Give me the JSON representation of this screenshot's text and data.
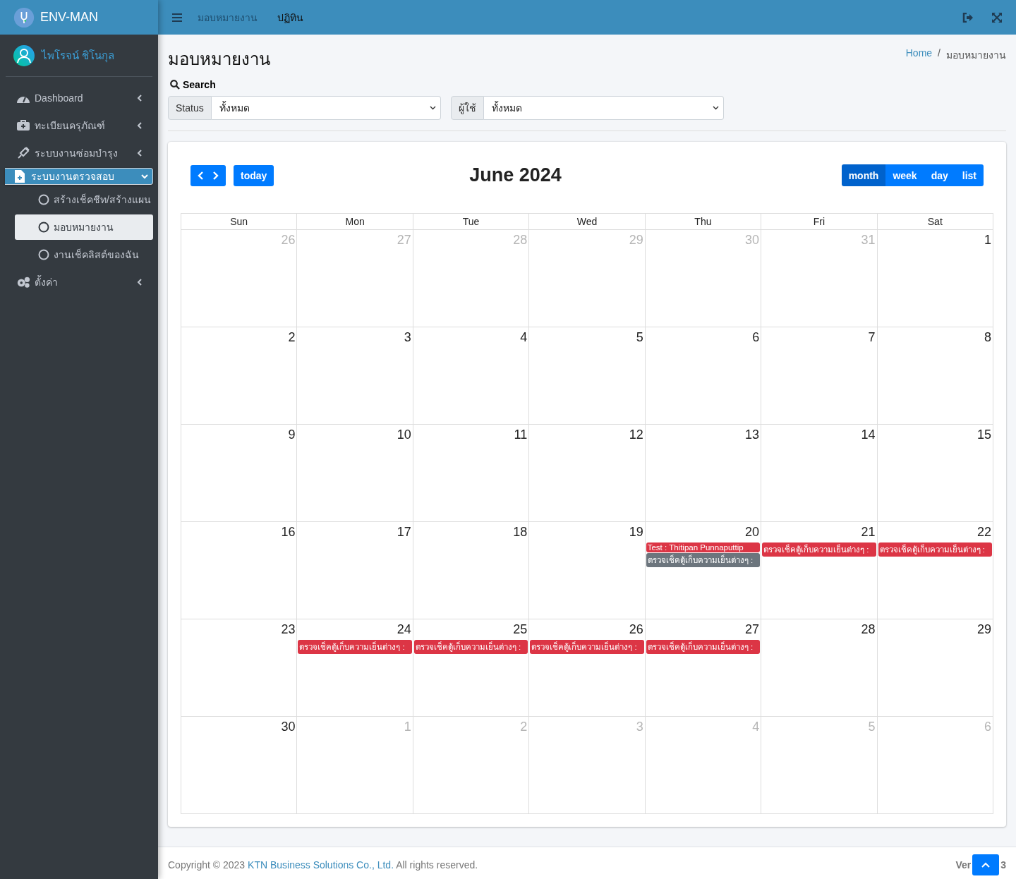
{
  "brand": {
    "title": "ENV-MAN"
  },
  "user": {
    "name": "ไพโรจน์ ชิโนกุล"
  },
  "sidebar": {
    "items": [
      {
        "label": "Dashboard",
        "expanded": false,
        "selected": false
      },
      {
        "label": "ทะเบียนครุภัณฑ์",
        "expanded": false,
        "selected": false
      },
      {
        "label": "ระบบงานซ่อมบำรุง",
        "expanded": false,
        "selected": false
      },
      {
        "label": "ระบบงานตรวจสอบ",
        "expanded": true,
        "selected": true,
        "children": [
          {
            "label": "สร้างเช็คชีท/สร้างแผน",
            "selected": false
          },
          {
            "label": "มอบหมายงาน",
            "selected": true
          },
          {
            "label": "งานเช็คลิสต์ของฉัน",
            "selected": false
          }
        ]
      },
      {
        "label": "ตั้งค่า",
        "expanded": false,
        "selected": false
      }
    ]
  },
  "navbar": {
    "links": [
      "มอบหมายงาน",
      "ปฏิทิน"
    ]
  },
  "page": {
    "title": "มอบหมายงาน",
    "breadcrumb": [
      "Home",
      "มอบหมายงาน"
    ],
    "breadcrumb_separator": "/"
  },
  "search": {
    "title": "Search",
    "filters": [
      {
        "label": "Status",
        "value": "ทั้งหมด"
      },
      {
        "label": "ผู้ใช้",
        "value": "ทั้งหมด"
      }
    ]
  },
  "calendar": {
    "title": "June 2024",
    "today": "today",
    "views": [
      {
        "label": "month",
        "selected": true
      },
      {
        "label": "week",
        "selected": false
      },
      {
        "label": "day",
        "selected": false
      },
      {
        "label": "list",
        "selected": false
      }
    ],
    "weekdays": [
      "Sun",
      "Mon",
      "Tue",
      "Wed",
      "Thu",
      "Fri",
      "Sat"
    ],
    "weeks": [
      [
        {
          "day": "26",
          "other_month": true
        },
        {
          "day": "27",
          "other_month": true
        },
        {
          "day": "28",
          "other_month": true
        },
        {
          "day": "29",
          "other_month": true
        },
        {
          "day": "30",
          "other_month": true
        },
        {
          "day": "31",
          "other_month": true
        },
        {
          "day": "1",
          "other_month": false
        }
      ],
      [
        {
          "day": "2",
          "other_month": false
        },
        {
          "day": "3",
          "other_month": false
        },
        {
          "day": "4",
          "other_month": false
        },
        {
          "day": "5",
          "other_month": false
        },
        {
          "day": "6",
          "other_month": false
        },
        {
          "day": "7",
          "other_month": false
        },
        {
          "day": "8",
          "other_month": false
        }
      ],
      [
        {
          "day": "9",
          "other_month": false
        },
        {
          "day": "10",
          "other_month": false
        },
        {
          "day": "11",
          "other_month": false
        },
        {
          "day": "12",
          "other_month": false
        },
        {
          "day": "13",
          "other_month": false
        },
        {
          "day": "14",
          "other_month": false
        },
        {
          "day": "15",
          "other_month": false
        }
      ],
      [
        {
          "day": "16",
          "other_month": false
        },
        {
          "day": "17",
          "other_month": false
        },
        {
          "day": "18",
          "other_month": false
        },
        {
          "day": "19",
          "other_month": false
        },
        {
          "day": "20",
          "other_month": false,
          "events": [
            {
              "title": "Test : Thitipan Punnaputtip",
              "color": "#dc3545"
            },
            {
              "title": "ตรวจเช็คตู้เก็บความเย็นต่างๆ :",
              "color": "#6c757d"
            }
          ]
        },
        {
          "day": "21",
          "other_month": false,
          "events": [
            {
              "title": "ตรวจเช็คตู้เก็บความเย็นต่างๆ :",
              "color": "#dc3545"
            }
          ]
        },
        {
          "day": "22",
          "other_month": false,
          "events": [
            {
              "title": "ตรวจเช็คตู้เก็บความเย็นต่างๆ :",
              "color": "#dc3545"
            }
          ]
        }
      ],
      [
        {
          "day": "23",
          "other_month": false
        },
        {
          "day": "24",
          "other_month": false,
          "events": [
            {
              "title": "ตรวจเช็คตู้เก็บความเย็นต่างๆ :",
              "color": "#dc3545"
            }
          ]
        },
        {
          "day": "25",
          "other_month": false,
          "events": [
            {
              "title": "ตรวจเช็คตู้เก็บความเย็นต่างๆ :",
              "color": "#dc3545"
            }
          ]
        },
        {
          "day": "26",
          "other_month": false,
          "events": [
            {
              "title": "ตรวจเช็คตู้เก็บความเย็นต่างๆ :",
              "color": "#dc3545"
            }
          ]
        },
        {
          "day": "27",
          "other_month": false,
          "events": [
            {
              "title": "ตรวจเช็คตู้เก็บความเย็นต่างๆ :",
              "color": "#dc3545"
            }
          ]
        },
        {
          "day": "28",
          "other_month": false
        },
        {
          "day": "29",
          "other_month": false
        }
      ],
      [
        {
          "day": "30",
          "other_month": false
        },
        {
          "day": "1",
          "other_month": true
        },
        {
          "day": "2",
          "other_month": true
        },
        {
          "day": "3",
          "other_month": true
        },
        {
          "day": "4",
          "other_month": true
        },
        {
          "day": "5",
          "other_month": true
        },
        {
          "day": "6",
          "other_month": true
        }
      ]
    ]
  },
  "footer": {
    "copyright": "Copyright © 2023",
    "company": "KTN Business Solutions Co., Ltd.",
    "rights": "All rights reserved.",
    "version_parts": [
      "Ver",
      "3"
    ]
  }
}
